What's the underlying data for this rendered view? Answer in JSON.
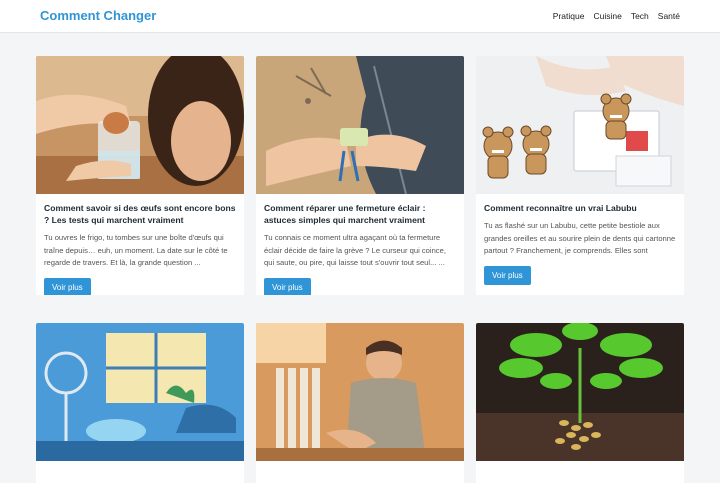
{
  "site": {
    "brand": "Comment Changer",
    "nav": [
      "Pratique",
      "Cuisine",
      "Tech",
      "Santé"
    ]
  },
  "cards": [
    {
      "title": "Comment savoir si des œufs sont encore bons ? Les tests qui marchent vraiment",
      "excerpt": "Tu ouvres le frigo, tu tombes sur une boîte d'œufs qui traîne depuis… euh, un moment. La date sur le côté te regarde de travers. Et là, la grande question ...",
      "button": "Voir plus",
      "image_subject": "egg-water-test"
    },
    {
      "title": "Comment réparer une fermeture éclair : astuces simples qui marchent vraiment",
      "excerpt": "Tu connais ce moment ultra agaçant où ta fermeture éclair décide de faire la grève ? Le curseur qui coince, qui saute, ou pire, qui laisse tout s'ouvrir tout seul... ...",
      "button": "Voir plus",
      "image_subject": "zipper-repair"
    },
    {
      "title": "Comment reconnaître un vrai Labubu",
      "excerpt": "Tu as flashé sur un Labubu, cette petite bestiole aux grandes oreilles et au sourire plein de dents qui cartonne partout ? Franchement, je comprends. Elles sont craquantes, un peu ...",
      "button": "Voir plus",
      "image_subject": "labubu-figures"
    },
    {
      "image_subject": "cooling-room-fan"
    },
    {
      "image_subject": "radiator-man"
    },
    {
      "image_subject": "peanut-plant"
    }
  ],
  "colors": {
    "accent": "#2f95d6",
    "background": "#f4f5f7"
  }
}
